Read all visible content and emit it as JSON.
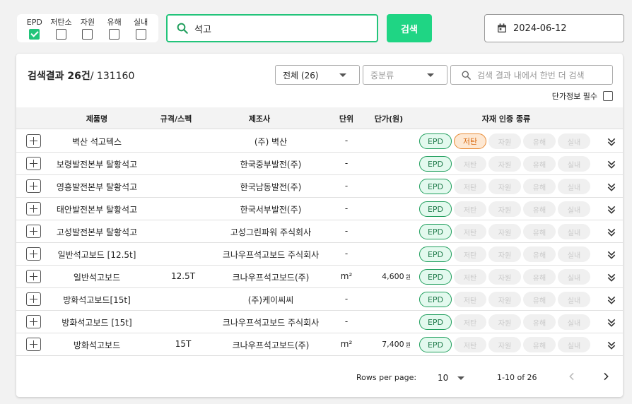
{
  "filters": [
    {
      "label": "EPD",
      "checked": true
    },
    {
      "label": "저탄소",
      "checked": false
    },
    {
      "label": "자원",
      "checked": false
    },
    {
      "label": "유해",
      "checked": false
    },
    {
      "label": "실내",
      "checked": false
    }
  ],
  "search": {
    "value": "석고",
    "button_label": "검색"
  },
  "date": {
    "value": "2024-06-12"
  },
  "results": {
    "title_bold": "검색결과 26건",
    "title_rest": "/ 131160"
  },
  "controls": {
    "category_all": "전체 (26)",
    "category_mid": "중분류",
    "search_within_placeholder": "검색 결과 내에서 한번 더 검색",
    "price_required_label": "단가정보 필수"
  },
  "table": {
    "headers": [
      "제품명",
      "규격/스펙",
      "제조사",
      "단위",
      "단가(원)",
      "자재 인증 종류"
    ],
    "badge_labels": [
      "EPD",
      "저탄",
      "자원",
      "유해",
      "실내"
    ],
    "rows": [
      {
        "name": "벽산 석고텍스",
        "spec": "",
        "maker": "(주) 벽산",
        "unit": "-",
        "price": "",
        "won": "",
        "active": [
          true,
          true,
          false,
          false,
          false
        ]
      },
      {
        "name": "보령발전본부 탈황석고",
        "spec": "",
        "maker": "한국중부발전(주)",
        "unit": "-",
        "price": "",
        "won": "",
        "active": [
          true,
          false,
          false,
          false,
          false
        ]
      },
      {
        "name": "영흥발전본부 탈황석고",
        "spec": "",
        "maker": "한국남동발전(주)",
        "unit": "-",
        "price": "",
        "won": "",
        "active": [
          true,
          false,
          false,
          false,
          false
        ]
      },
      {
        "name": "태안발전본부 탈황석고",
        "spec": "",
        "maker": "한국서부발전(주)",
        "unit": "-",
        "price": "",
        "won": "",
        "active": [
          true,
          false,
          false,
          false,
          false
        ]
      },
      {
        "name": "고성발전본부 탈황석고",
        "spec": "",
        "maker": "고성그린파워 주식회사",
        "unit": "-",
        "price": "",
        "won": "",
        "active": [
          true,
          false,
          false,
          false,
          false
        ]
      },
      {
        "name": "일반석고보드 [12.5t]",
        "spec": "",
        "maker": "크나우프석고보드 주식회사",
        "unit": "-",
        "price": "",
        "won": "",
        "active": [
          true,
          false,
          false,
          false,
          false
        ]
      },
      {
        "name": "일반석고보드",
        "spec": "12.5T",
        "maker": "크나우프석고보드(주)",
        "unit": "m²",
        "price": "4,600",
        "won": "원",
        "active": [
          true,
          false,
          false,
          false,
          false
        ]
      },
      {
        "name": "방화석고보드[15t]",
        "spec": "",
        "maker": "(주)케이씨씨",
        "unit": "-",
        "price": "",
        "won": "",
        "active": [
          true,
          false,
          false,
          false,
          false
        ]
      },
      {
        "name": "방화석고보드 [15t]",
        "spec": "",
        "maker": "크나우프석고보드 주식회사",
        "unit": "-",
        "price": "",
        "won": "",
        "active": [
          true,
          false,
          false,
          false,
          false
        ]
      },
      {
        "name": "방화석고보드",
        "spec": "15T",
        "maker": "크나우프석고보드(주)",
        "unit": "m²",
        "price": "7,400",
        "won": "원",
        "active": [
          true,
          false,
          false,
          false,
          false
        ]
      }
    ]
  },
  "pagination": {
    "rows_per_page_label": "Rows per page:",
    "rows_per_page": "10",
    "range": "1-10 of 26"
  },
  "colors": {
    "accent": "#1fd584",
    "epd_border": "#1f9e5c",
    "low_carbon": "#e88a33"
  }
}
